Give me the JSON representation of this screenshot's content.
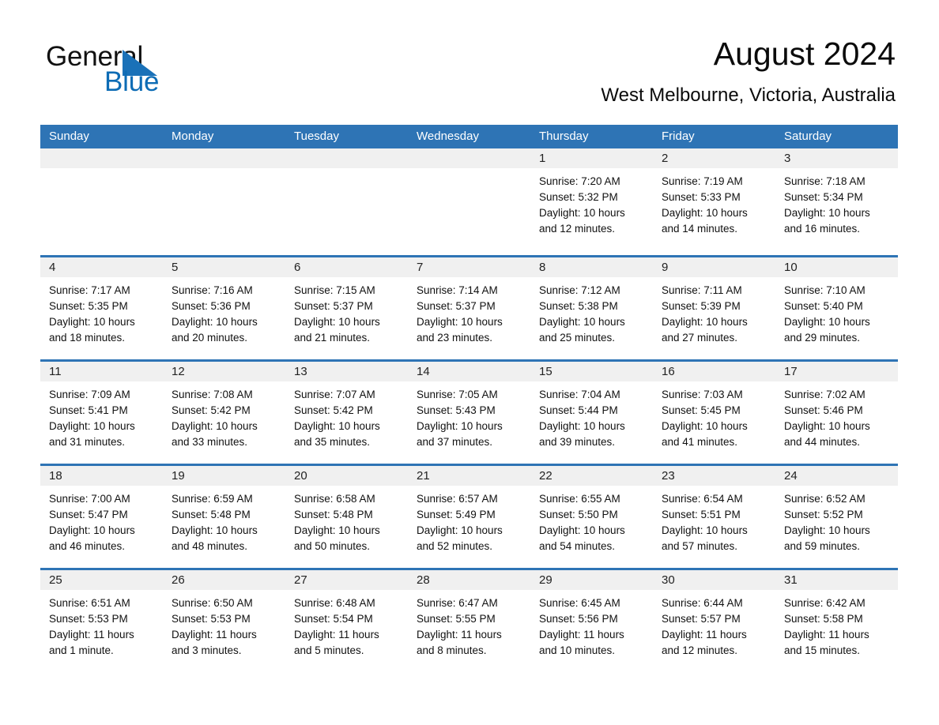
{
  "brand": {
    "word_one": "General",
    "word_two": "Blue",
    "triangle_color": "#1a71b8",
    "blue_text_color": "#0d6cb5",
    "icon": "general-blue-logo"
  },
  "header": {
    "title": "August 2024",
    "location": "West Melbourne, Victoria, Australia"
  },
  "theme": {
    "header_blue": "#2e74b5",
    "daynum_gray": "#f0f0f0",
    "text_black": "#111111"
  },
  "weekdays": [
    "Sunday",
    "Monday",
    "Tuesday",
    "Wednesday",
    "Thursday",
    "Friday",
    "Saturday"
  ],
  "weeks": [
    [
      {
        "day": "",
        "sunrise": "",
        "sunset": "",
        "daylight_line1": "",
        "daylight_line2": "",
        "empty": true
      },
      {
        "day": "",
        "sunrise": "",
        "sunset": "",
        "daylight_line1": "",
        "daylight_line2": "",
        "empty": true
      },
      {
        "day": "",
        "sunrise": "",
        "sunset": "",
        "daylight_line1": "",
        "daylight_line2": "",
        "empty": true
      },
      {
        "day": "",
        "sunrise": "",
        "sunset": "",
        "daylight_line1": "",
        "daylight_line2": "",
        "empty": true
      },
      {
        "day": "1",
        "sunrise": "Sunrise: 7:20 AM",
        "sunset": "Sunset: 5:32 PM",
        "daylight_line1": "Daylight: 10 hours",
        "daylight_line2": "and 12 minutes."
      },
      {
        "day": "2",
        "sunrise": "Sunrise: 7:19 AM",
        "sunset": "Sunset: 5:33 PM",
        "daylight_line1": "Daylight: 10 hours",
        "daylight_line2": "and 14 minutes."
      },
      {
        "day": "3",
        "sunrise": "Sunrise: 7:18 AM",
        "sunset": "Sunset: 5:34 PM",
        "daylight_line1": "Daylight: 10 hours",
        "daylight_line2": "and 16 minutes."
      }
    ],
    [
      {
        "day": "4",
        "sunrise": "Sunrise: 7:17 AM",
        "sunset": "Sunset: 5:35 PM",
        "daylight_line1": "Daylight: 10 hours",
        "daylight_line2": "and 18 minutes."
      },
      {
        "day": "5",
        "sunrise": "Sunrise: 7:16 AM",
        "sunset": "Sunset: 5:36 PM",
        "daylight_line1": "Daylight: 10 hours",
        "daylight_line2": "and 20 minutes."
      },
      {
        "day": "6",
        "sunrise": "Sunrise: 7:15 AM",
        "sunset": "Sunset: 5:37 PM",
        "daylight_line1": "Daylight: 10 hours",
        "daylight_line2": "and 21 minutes."
      },
      {
        "day": "7",
        "sunrise": "Sunrise: 7:14 AM",
        "sunset": "Sunset: 5:37 PM",
        "daylight_line1": "Daylight: 10 hours",
        "daylight_line2": "and 23 minutes."
      },
      {
        "day": "8",
        "sunrise": "Sunrise: 7:12 AM",
        "sunset": "Sunset: 5:38 PM",
        "daylight_line1": "Daylight: 10 hours",
        "daylight_line2": "and 25 minutes."
      },
      {
        "day": "9",
        "sunrise": "Sunrise: 7:11 AM",
        "sunset": "Sunset: 5:39 PM",
        "daylight_line1": "Daylight: 10 hours",
        "daylight_line2": "and 27 minutes."
      },
      {
        "day": "10",
        "sunrise": "Sunrise: 7:10 AM",
        "sunset": "Sunset: 5:40 PM",
        "daylight_line1": "Daylight: 10 hours",
        "daylight_line2": "and 29 minutes."
      }
    ],
    [
      {
        "day": "11",
        "sunrise": "Sunrise: 7:09 AM",
        "sunset": "Sunset: 5:41 PM",
        "daylight_line1": "Daylight: 10 hours",
        "daylight_line2": "and 31 minutes."
      },
      {
        "day": "12",
        "sunrise": "Sunrise: 7:08 AM",
        "sunset": "Sunset: 5:42 PM",
        "daylight_line1": "Daylight: 10 hours",
        "daylight_line2": "and 33 minutes."
      },
      {
        "day": "13",
        "sunrise": "Sunrise: 7:07 AM",
        "sunset": "Sunset: 5:42 PM",
        "daylight_line1": "Daylight: 10 hours",
        "daylight_line2": "and 35 minutes."
      },
      {
        "day": "14",
        "sunrise": "Sunrise: 7:05 AM",
        "sunset": "Sunset: 5:43 PM",
        "daylight_line1": "Daylight: 10 hours",
        "daylight_line2": "and 37 minutes."
      },
      {
        "day": "15",
        "sunrise": "Sunrise: 7:04 AM",
        "sunset": "Sunset: 5:44 PM",
        "daylight_line1": "Daylight: 10 hours",
        "daylight_line2": "and 39 minutes."
      },
      {
        "day": "16",
        "sunrise": "Sunrise: 7:03 AM",
        "sunset": "Sunset: 5:45 PM",
        "daylight_line1": "Daylight: 10 hours",
        "daylight_line2": "and 41 minutes."
      },
      {
        "day": "17",
        "sunrise": "Sunrise: 7:02 AM",
        "sunset": "Sunset: 5:46 PM",
        "daylight_line1": "Daylight: 10 hours",
        "daylight_line2": "and 44 minutes."
      }
    ],
    [
      {
        "day": "18",
        "sunrise": "Sunrise: 7:00 AM",
        "sunset": "Sunset: 5:47 PM",
        "daylight_line1": "Daylight: 10 hours",
        "daylight_line2": "and 46 minutes."
      },
      {
        "day": "19",
        "sunrise": "Sunrise: 6:59 AM",
        "sunset": "Sunset: 5:48 PM",
        "daylight_line1": "Daylight: 10 hours",
        "daylight_line2": "and 48 minutes."
      },
      {
        "day": "20",
        "sunrise": "Sunrise: 6:58 AM",
        "sunset": "Sunset: 5:48 PM",
        "daylight_line1": "Daylight: 10 hours",
        "daylight_line2": "and 50 minutes."
      },
      {
        "day": "21",
        "sunrise": "Sunrise: 6:57 AM",
        "sunset": "Sunset: 5:49 PM",
        "daylight_line1": "Daylight: 10 hours",
        "daylight_line2": "and 52 minutes."
      },
      {
        "day": "22",
        "sunrise": "Sunrise: 6:55 AM",
        "sunset": "Sunset: 5:50 PM",
        "daylight_line1": "Daylight: 10 hours",
        "daylight_line2": "and 54 minutes."
      },
      {
        "day": "23",
        "sunrise": "Sunrise: 6:54 AM",
        "sunset": "Sunset: 5:51 PM",
        "daylight_line1": "Daylight: 10 hours",
        "daylight_line2": "and 57 minutes."
      },
      {
        "day": "24",
        "sunrise": "Sunrise: 6:52 AM",
        "sunset": "Sunset: 5:52 PM",
        "daylight_line1": "Daylight: 10 hours",
        "daylight_line2": "and 59 minutes."
      }
    ],
    [
      {
        "day": "25",
        "sunrise": "Sunrise: 6:51 AM",
        "sunset": "Sunset: 5:53 PM",
        "daylight_line1": "Daylight: 11 hours",
        "daylight_line2": "and 1 minute."
      },
      {
        "day": "26",
        "sunrise": "Sunrise: 6:50 AM",
        "sunset": "Sunset: 5:53 PM",
        "daylight_line1": "Daylight: 11 hours",
        "daylight_line2": "and 3 minutes."
      },
      {
        "day": "27",
        "sunrise": "Sunrise: 6:48 AM",
        "sunset": "Sunset: 5:54 PM",
        "daylight_line1": "Daylight: 11 hours",
        "daylight_line2": "and 5 minutes."
      },
      {
        "day": "28",
        "sunrise": "Sunrise: 6:47 AM",
        "sunset": "Sunset: 5:55 PM",
        "daylight_line1": "Daylight: 11 hours",
        "daylight_line2": "and 8 minutes."
      },
      {
        "day": "29",
        "sunrise": "Sunrise: 6:45 AM",
        "sunset": "Sunset: 5:56 PM",
        "daylight_line1": "Daylight: 11 hours",
        "daylight_line2": "and 10 minutes."
      },
      {
        "day": "30",
        "sunrise": "Sunrise: 6:44 AM",
        "sunset": "Sunset: 5:57 PM",
        "daylight_line1": "Daylight: 11 hours",
        "daylight_line2": "and 12 minutes."
      },
      {
        "day": "31",
        "sunrise": "Sunrise: 6:42 AM",
        "sunset": "Sunset: 5:58 PM",
        "daylight_line1": "Daylight: 11 hours",
        "daylight_line2": "and 15 minutes."
      }
    ]
  ]
}
